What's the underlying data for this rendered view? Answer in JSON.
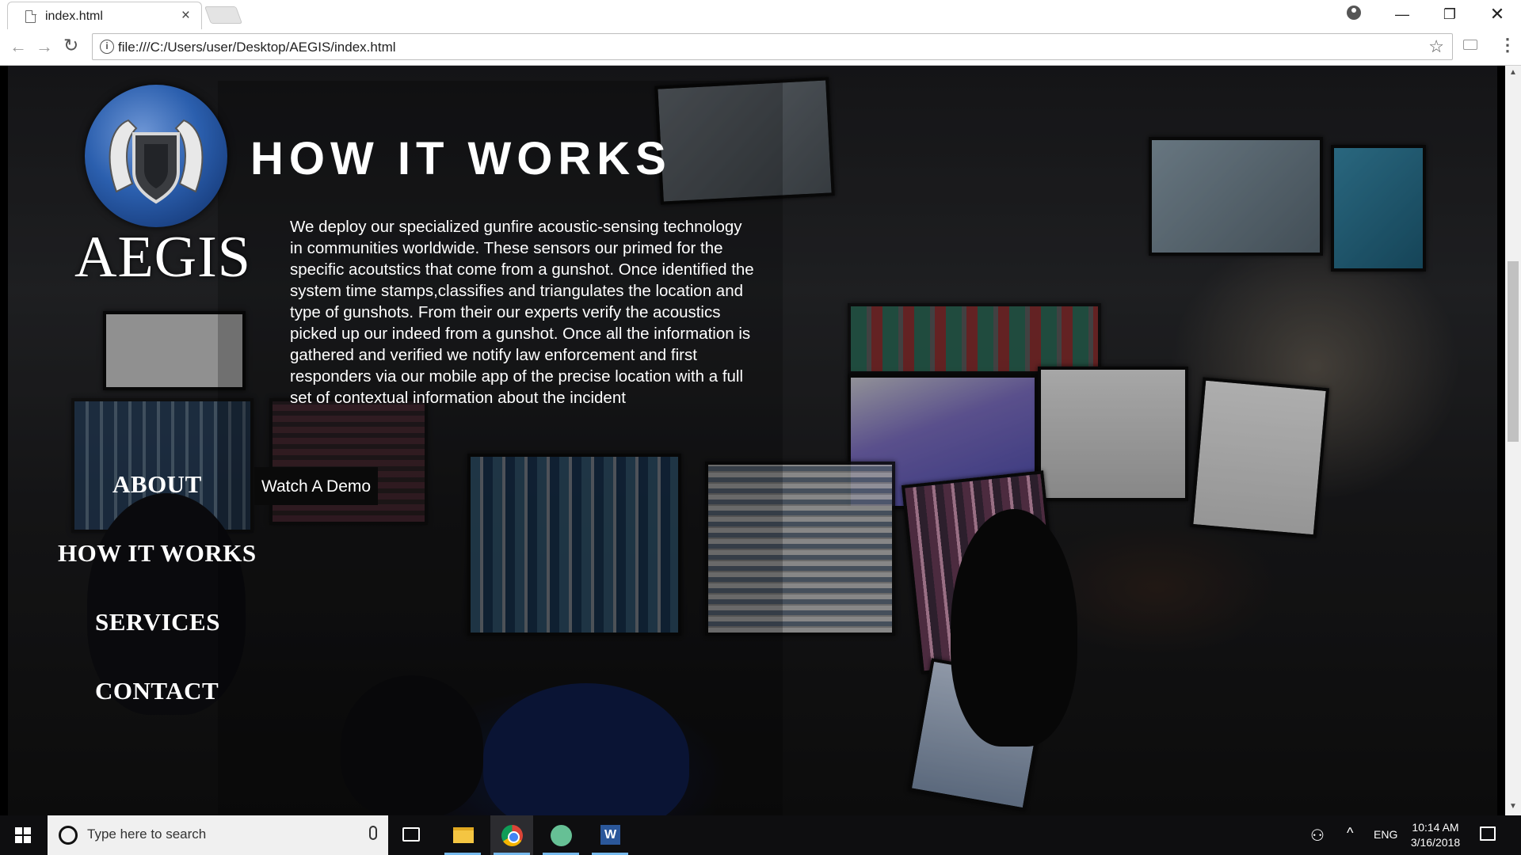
{
  "browser": {
    "tab_title": "index.html",
    "tab_close": "×",
    "url": "file:///C:/Users/user/Desktop/AEGIS/index.html",
    "window_controls": {
      "minimize": "—",
      "maximize": "❐",
      "close": "✕"
    }
  },
  "page": {
    "brand": "AEGIS",
    "heading": "HOW IT WORKS",
    "body": "We deploy our specialized gunfire acoustic-sensing technology in communities worldwide. These sensors our primed for the specific acoutstics that come from a gunshot. Once identified the system time stamps,classifies and triangulates the location and type of gunshots. From their our experts verify the acoustics picked up our indeed from a gunshot. Once all the information is gathered and verified we notify law enforcement and first responders via our mobile app of the precise location with a full set of contextual information about the incident",
    "nav": {
      "about": "ABOUT",
      "how": "HOW IT WORKS",
      "services": "SERVICES",
      "contact": "CONTACT"
    },
    "demo_button": "Watch A Demo"
  },
  "taskbar": {
    "search_placeholder": "Type here to search",
    "language": "ENG",
    "time": "10:14 AM",
    "date": "3/16/2018",
    "apps": [
      "file-explorer-icon",
      "chrome-icon",
      "atom-icon",
      "word-icon"
    ]
  }
}
